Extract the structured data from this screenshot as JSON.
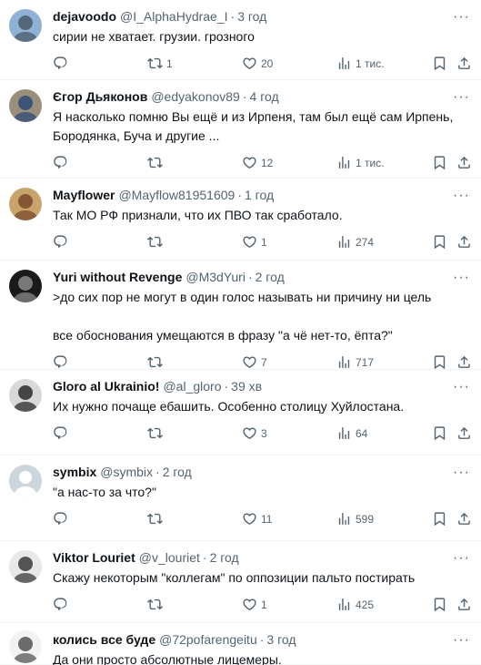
{
  "icons": {
    "reply": "reply-icon",
    "retweet": "retweet-icon",
    "like": "heart-icon",
    "views": "analytics-icon",
    "bookmark": "bookmark-icon",
    "share": "share-icon",
    "more": "more-icon"
  },
  "more_glyph": "···",
  "tweets": [
    {
      "name": "dejavoodo",
      "handle": "@I_AlphaHydrae_I",
      "sep": "·",
      "time": "3 год",
      "lines": [
        "сирии не хватает. грузии. грозного"
      ],
      "reply": "",
      "retweets": "1",
      "likes": "20",
      "views": "1 тис.",
      "avatar_colors": [
        "#8fb1d6",
        "#4a5a6a"
      ]
    },
    {
      "name": "Єгор Дьяконов",
      "handle": "@edyakonov89",
      "sep": "·",
      "time": "4 год",
      "lines": [
        "Я насколько помню Вы ещё и из Ирпеня, там был ещё сам Ирпень,",
        "Бородянка, Буча и другие ..."
      ],
      "reply": "",
      "retweets": "",
      "likes": "12",
      "views": "1 тис.",
      "avatar_colors": [
        "#9a8f7a",
        "#2e4a76"
      ]
    },
    {
      "name": "Mayflower",
      "handle": "@Mayflow81951609",
      "sep": "·",
      "time": "1 год",
      "lines": [
        "Так МО РФ признали, что их ПВО так сработало."
      ],
      "reply": "",
      "retweets": "",
      "likes": "1",
      "views": "274",
      "avatar_colors": [
        "#c9a46a",
        "#7a4a2a"
      ]
    },
    {
      "name": "Yuri without Revenge",
      "handle": "@M3dYuri",
      "sep": "·",
      "time": "2 год",
      "lines": [
        ">до сих пор не могут в один голос называть ни причину ни цель",
        "",
        "все обоснования умещаются в фразу \"а чё нет-то, ёпта?\""
      ],
      "reply": "",
      "retweets": "",
      "likes": "7",
      "views": "717",
      "avatar_colors": [
        "#1a1a1a",
        "#8a8a8a"
      ]
    },
    {
      "name": "Gloro al Ukrainio!",
      "handle": "@al_gloro",
      "sep": "·",
      "time": "39 хв",
      "lines": [
        "Их нужно почаще ебашить. Особенно столицу Хуйлостана."
      ],
      "reply": "",
      "retweets": "",
      "likes": "3",
      "views": "64",
      "avatar_colors": [
        "#d8d8d8",
        "#2a2a2a"
      ]
    },
    {
      "name": "symbix",
      "handle": "@symbix",
      "sep": "·",
      "time": "2 год",
      "lines": [
        "\"а нас-то за что?\""
      ],
      "reply": "",
      "retweets": "",
      "likes": "11",
      "views": "599",
      "avatar_colors": [
        "#ccd6dd",
        "#ffffff"
      ]
    },
    {
      "name": "Viktor Louriet",
      "handle": "@v_louriet",
      "sep": "·",
      "time": "2 год",
      "lines": [
        "Скажу некоторым \"коллегам\" по оппозиции пальто постирать"
      ],
      "reply": "",
      "retweets": "",
      "likes": "1",
      "views": "425",
      "avatar_colors": [
        "#e8e8e8",
        "#3a3a3a"
      ]
    },
    {
      "name": "колись все буде",
      "handle": "@72pofarengeitu",
      "sep": "·",
      "time": "3 год",
      "lines": [
        "Да они просто абсолютные лицемеры."
      ],
      "reply": "",
      "retweets": "",
      "likes": "",
      "views": "",
      "avatar_colors": [
        "#f2f2f2",
        "#555555"
      ]
    }
  ]
}
